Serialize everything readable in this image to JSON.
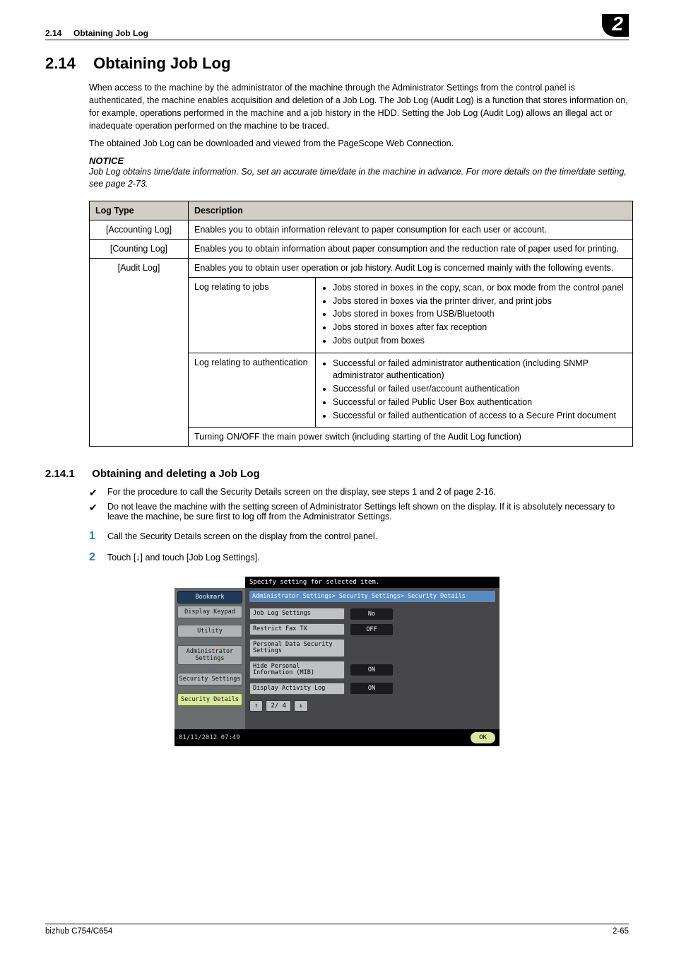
{
  "header": {
    "section_no": "2.14",
    "section_title": "Obtaining Job Log",
    "chapter_badge": "2"
  },
  "heading": {
    "num": "2.14",
    "title": "Obtaining Job Log"
  },
  "para1": "When access to the machine by the administrator of the machine through the Administrator Settings from the control panel is authenticated, the machine enables acquisition and deletion of a Job Log. The Job Log (Audit Log) is a function that stores information on, for example, operations performed in the machine and a job history in the HDD. Setting the Job Log (Audit Log) allows an illegal act or inadequate operation performed on the machine to be traced.",
  "para2": "The obtained Job Log can be downloaded and viewed from the PageScope Web Connection.",
  "notice_label": "NOTICE",
  "notice_text": "Job Log obtains time/date information. So, set an accurate time/date in the machine in advance. For more details on the time/date setting, see page 2-73.",
  "table": {
    "head": {
      "c1": "Log Type",
      "c2": "Description"
    },
    "rows": {
      "accounting": {
        "type": "[Accounting Log]",
        "desc": "Enables you to obtain information relevant to paper consumption for each user or account."
      },
      "counting": {
        "type": "[Counting Log]",
        "desc": "Enables you to obtain information about paper consumption and the reduction rate of paper used for printing."
      },
      "audit": {
        "type": "[Audit Log]",
        "desc": "Enables you to obtain user operation or job history. Audit Log is concerned mainly with the following events.",
        "jobs_label": "Log relating to jobs",
        "jobs_items": [
          "Jobs stored in boxes in the copy, scan, or box mode from the control panel",
          "Jobs stored in boxes via the printer driver, and print jobs",
          "Jobs stored in boxes from USB/Bluetooth",
          "Jobs stored in boxes after fax reception",
          "Jobs output from boxes"
        ],
        "auth_label": "Log relating to authentication",
        "auth_items": [
          "Successful or failed administrator authentication (including SNMP administrator authentication)",
          "Successful or failed user/account authentication",
          "Successful or failed Public User Box authentication",
          "Successful or failed authentication of access to a Secure Print document"
        ],
        "power": "Turning ON/OFF the main power switch (including starting of the Audit Log function)"
      }
    }
  },
  "sub": {
    "num": "2.14.1",
    "title": "Obtaining and deleting a Job Log"
  },
  "checks": [
    "For the procedure to call the Security Details screen on the display, see steps 1 and 2 of page 2-16.",
    "Do not leave the machine with the setting screen of Administrator Settings left shown on the display. If it is absolutely necessary to leave the machine, be sure first to log off from the Administrator Settings."
  ],
  "steps": [
    "Call the Security Details screen on the display from the control panel.",
    "Touch [↓] and touch [Job Log Settings]."
  ],
  "panel": {
    "topbar": "Specify setting for selected item.",
    "titlebar": "Administrator Settings> Security Settings> Security Details",
    "left": {
      "bookmark": "Bookmark",
      "keypad": "Display Keypad",
      "utility": "Utility",
      "admin": "Administrator Settings",
      "security": "Security Settings",
      "details": "Security Details"
    },
    "rows": [
      {
        "label": "Job Log Settings",
        "val": "No"
      },
      {
        "label": "Restrict Fax TX",
        "val": "OFF"
      },
      {
        "label": "Personal Data Security Settings",
        "val": ""
      },
      {
        "label": "Hide Personal Information (MIB)",
        "val": "ON"
      },
      {
        "label": "Display Activity Log",
        "val": "ON"
      }
    ],
    "pager": {
      "up": "↑",
      "page": "2/ 4",
      "down": "↓"
    },
    "footer_time": "01/11/2012   07:49",
    "ok": "OK"
  },
  "footer": {
    "model": "bizhub C754/C654",
    "page": "2-65"
  }
}
